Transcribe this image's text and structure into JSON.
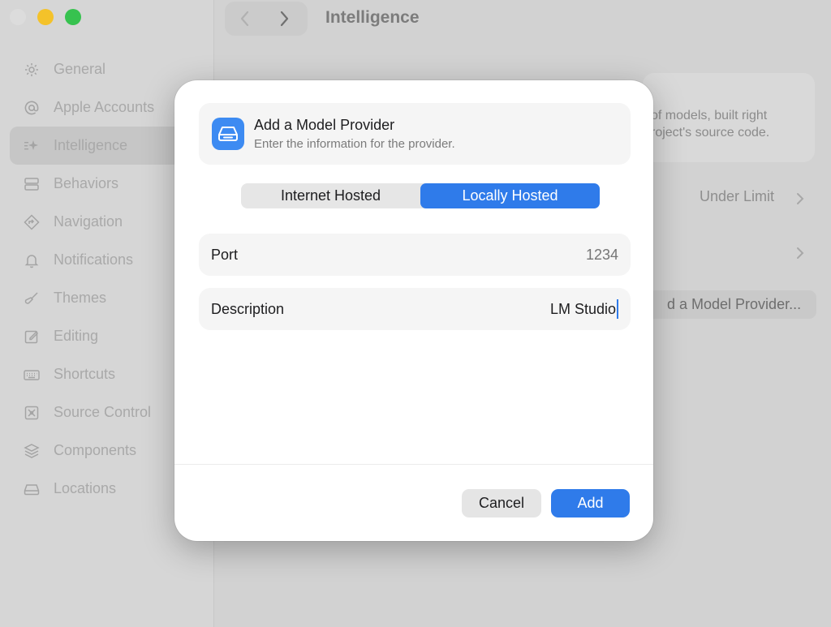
{
  "window": {
    "title": "Intelligence",
    "traffic_lights": [
      "close",
      "minimize",
      "zoom"
    ]
  },
  "sidebar": {
    "items": [
      {
        "label": "General",
        "icon": "gear-icon"
      },
      {
        "label": "Apple Accounts",
        "icon": "at-icon"
      },
      {
        "label": "Intelligence",
        "icon": "sparkles-icon",
        "selected": true
      },
      {
        "label": "Behaviors",
        "icon": "behaviors-icon"
      },
      {
        "label": "Navigation",
        "icon": "navigation-icon"
      },
      {
        "label": "Notifications",
        "icon": "bell-icon"
      },
      {
        "label": "Themes",
        "icon": "brush-icon"
      },
      {
        "label": "Editing",
        "icon": "edit-icon"
      },
      {
        "label": "Shortcuts",
        "icon": "keyboard-icon"
      },
      {
        "label": "Source Control",
        "icon": "source-control-icon"
      },
      {
        "label": "Components",
        "icon": "layers-icon"
      },
      {
        "label": "Locations",
        "icon": "drive-icon"
      }
    ]
  },
  "background": {
    "card_line1": "of models, built right",
    "card_line2": "roject's source code.",
    "usage_value": "Under Limit",
    "add_provider_partial": "d a Model Provider..."
  },
  "dialog": {
    "title": "Add a Model Provider",
    "subtitle": "Enter the information for the provider.",
    "icon": "drive-icon",
    "segments": [
      {
        "label": "Internet Hosted",
        "selected": false
      },
      {
        "label": "Locally Hosted",
        "selected": true
      }
    ],
    "port": {
      "label": "Port",
      "value": "",
      "placeholder": "1234"
    },
    "description": {
      "label": "Description",
      "value": "LM Studio"
    },
    "cancel_label": "Cancel",
    "add_label": "Add"
  },
  "colors": {
    "accent": "#2f7bea",
    "traffic_close": "#dcdcdc",
    "traffic_minimize": "#f4c22a",
    "traffic_zoom": "#37c24f"
  }
}
